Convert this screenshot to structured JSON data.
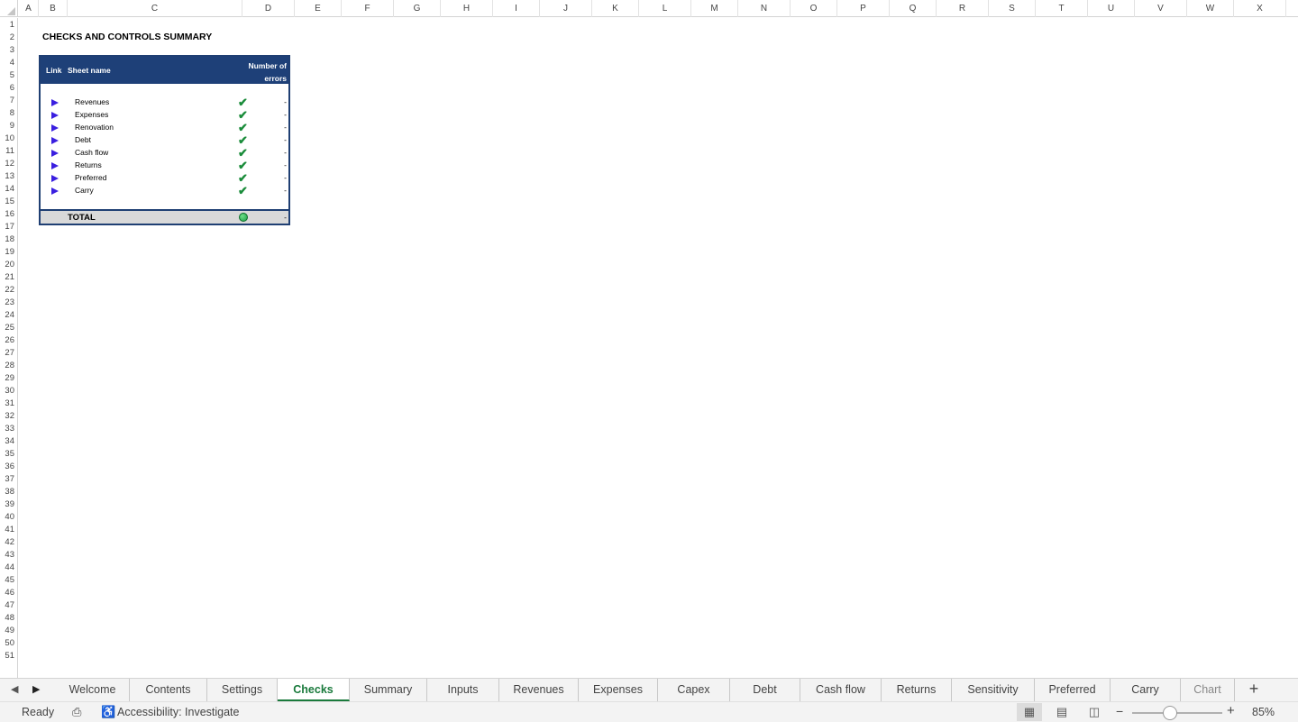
{
  "columns": [
    "A",
    "B",
    "C",
    "D",
    "E",
    "F",
    "G",
    "H",
    "I",
    "J",
    "K",
    "L",
    "M",
    "N",
    "O",
    "P",
    "Q",
    "R",
    "S",
    "T",
    "U",
    "V",
    "W",
    "X"
  ],
  "rows": [
    "1",
    "2",
    "3",
    "4",
    "5",
    "6",
    "7",
    "8",
    "9",
    "10",
    "11",
    "12",
    "13",
    "14",
    "15",
    "16",
    "17",
    "18",
    "19",
    "20",
    "21",
    "22",
    "23",
    "24",
    "25",
    "26",
    "27",
    "28",
    "29",
    "30",
    "31",
    "32",
    "33",
    "34",
    "35",
    "36",
    "37",
    "38",
    "39",
    "40",
    "41",
    "42",
    "43",
    "44",
    "45",
    "46",
    "47",
    "48",
    "49",
    "50",
    "51"
  ],
  "sheet": {
    "title": "CHECKS AND CONTROLS SUMMARY",
    "table": {
      "header_link": "Link",
      "header_sheet": "Sheet name",
      "header_errors_line1": "Number of",
      "header_errors_line2": "errors",
      "rows": [
        {
          "name": "Revenues",
          "errors": "-"
        },
        {
          "name": "Expenses",
          "errors": "-"
        },
        {
          "name": "Renovation",
          "errors": "-"
        },
        {
          "name": "Debt",
          "errors": "-"
        },
        {
          "name": "Cash flow",
          "errors": "-"
        },
        {
          "name": "Returns",
          "errors": "-"
        },
        {
          "name": "Preferred",
          "errors": "-"
        },
        {
          "name": "Carry",
          "errors": "-"
        }
      ],
      "total_label": "TOTAL",
      "total_errors": "-"
    }
  },
  "tabs": [
    "Welcome",
    "Contents",
    "Settings",
    "Checks",
    "Summary",
    "Inputs",
    "Revenues",
    "Expenses",
    "Capex",
    "Debt",
    "Cash flow",
    "Returns",
    "Sensitivity",
    "Preferred",
    "Carry",
    "Chart"
  ],
  "active_tab": "Checks",
  "status": {
    "ready": "Ready",
    "accessibility": "Accessibility: Investigate",
    "zoom": "85%"
  },
  "colors": {
    "header_bg": "#1e4078",
    "check": "#1a8c3a",
    "arrow": "#3a1fe0",
    "active_tab": "#1a7a3c"
  }
}
